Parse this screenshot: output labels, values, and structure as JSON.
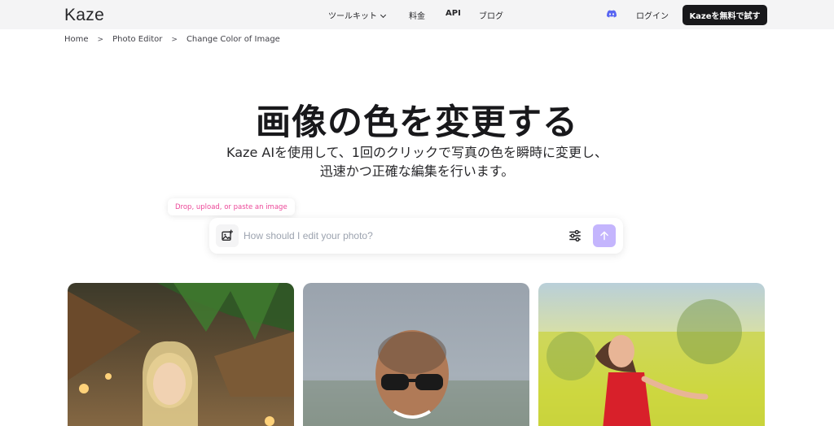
{
  "header": {
    "logo": "Kaze",
    "nav": [
      {
        "label": "ツールキット",
        "has_dropdown": true
      },
      {
        "label": "料金"
      },
      {
        "label": "API"
      },
      {
        "label": "ブログ"
      }
    ],
    "login_label": "ログイン",
    "cta_label": "Kazeを無料で試す",
    "discord_icon": "discord-icon"
  },
  "breadcrumb": [
    "Home",
    "Photo Editor",
    "Change Color of Image"
  ],
  "hero": {
    "title": "画像の色を変更する",
    "subtitle_line1": "Kaze AIを使用して、1回のクリックで写真の色を瞬時に変更し、",
    "subtitle_line2": "迅速かつ正確な編集を行います。"
  },
  "tooltip": {
    "text": "Drop, upload, or paste an image"
  },
  "prompt": {
    "placeholder": "How should I edit your photo?",
    "value": ""
  },
  "colors": {
    "accent": "#c4b5fd",
    "cta_bg": "#18181b",
    "tooltip_text": "#ec4899"
  }
}
